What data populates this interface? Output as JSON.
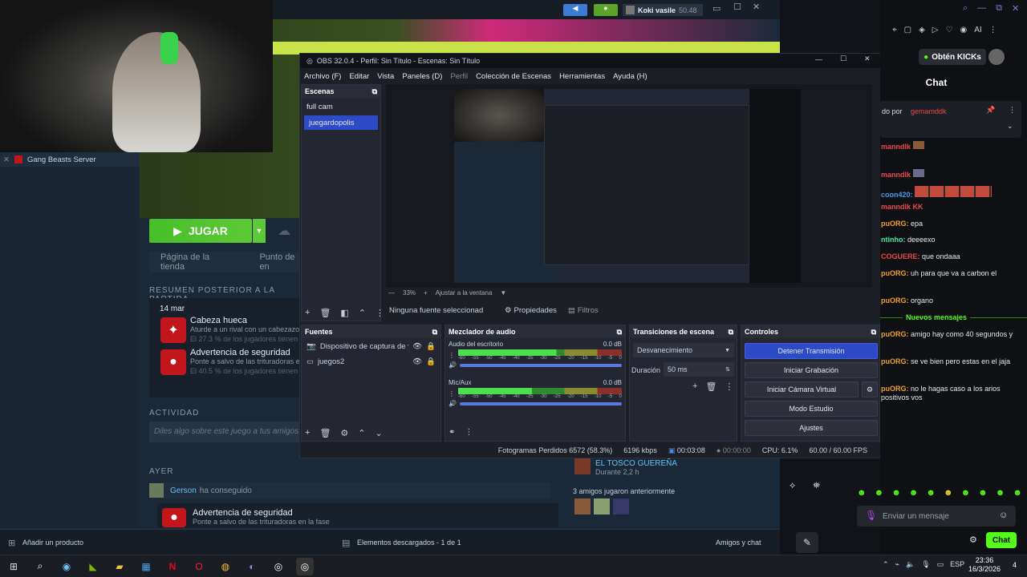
{
  "steam": {
    "game_title": "Gang Beasts Server",
    "user_name": "Koki vasile",
    "user_balance": "50.48",
    "play_label": "JUGAR",
    "tab_store": "Página de la tienda",
    "tab_point": "Punto de en",
    "summary_title": "RESUMEN POSTERIOR A LA PARTIDA",
    "summary_date": "14 mar",
    "achievements": [
      {
        "title": "Cabeza hueca",
        "desc": "Aturde a un rival con un cabezazo",
        "pct": "El 27.3 % de los jugadores tienen"
      },
      {
        "title": "Advertencia de seguridad",
        "desc": "Ponte a salvo de las trituradoras e",
        "pct": "El 40.5 % de los jugadores tienen"
      }
    ],
    "activity_title": "ACTIVIDAD",
    "comment_placeholder": "Diles algo sobre este juego a tus amigos...",
    "yesterday": "AYER",
    "friend_name": "Gerson",
    "friend_action": "ha conseguido",
    "friend_ach_title": "Advertencia de seguridad",
    "friend_ach_desc": "Ponte a salvo de las trituradoras en la fase",
    "side_friend": "EL TOSCO GUEREÑA",
    "side_friend_time": "Durante 2,2 h",
    "friends_played": "3 amigos jugaron anteriormente",
    "add_product": "Añadir un producto",
    "downloads": "Elementos descargados - 1 de 1",
    "friends_chat": "Amigos y chat"
  },
  "obs": {
    "title": "OBS 32.0.4 - Perfil: Sin Título - Escenas: Sin Título",
    "menu": [
      "Archivo (F)",
      "Editar",
      "Vista",
      "Paneles (D)",
      "Perfil",
      "Colección de Escenas",
      "Herramientas",
      "Ayuda (H)"
    ],
    "scenes_title": "Escenas",
    "scenes": [
      "full cam",
      "juegardopolis"
    ],
    "zoom": "33%",
    "fit_label": "Ajustar a la ventana",
    "no_source": "Ninguna fuente seleccionad",
    "properties": "Propiedades",
    "filters": "Filtros",
    "sources_title": "Fuentes",
    "sources": [
      "Dispositivo de captura de vid",
      "juegos2"
    ],
    "mixer_title": "Mezclador de audio",
    "mixer_channels": [
      {
        "name": "Audio del escritorio",
        "db": "0.0 dB"
      },
      {
        "name": "Mic/Aux",
        "db": "0.0 dB"
      }
    ],
    "mixer_ticks": [
      "-60",
      "-55",
      "-50",
      "-45",
      "-40",
      "-35",
      "-30",
      "-25",
      "-20",
      "-15",
      "-10",
      "-5",
      "0"
    ],
    "transitions_title": "Transiciones de escena",
    "transition_value": "Desvanecimiento",
    "duration_label": "Duración",
    "duration_value": "50 ms",
    "controls_title": "Controles",
    "controls": [
      "Detener Transmisión",
      "Iniciar Grabación",
      "Iniciar Cámara Virtual",
      "Modo Estudio",
      "Ajustes"
    ],
    "status": {
      "dropped": "Fotogramas Perdidos 6572 (58.3%)",
      "kbps": "6196 kbps",
      "stream_time": "00:03:08",
      "rec_time": "00:00:00",
      "cpu": "CPU: 6.1%",
      "fps": "60.00 / 60.00 FPS"
    }
  },
  "kick": {
    "get_kicks": "Obtén KICKs",
    "chat_title": "Chat",
    "pinned_by": "do por",
    "pinned_user": "gemamddk",
    "messages": [
      {
        "user": "manndlk",
        "text": ""
      },
      {
        "user": "manndlk",
        "text": ""
      },
      {
        "user": "coon420:",
        "text": ""
      },
      {
        "user": "manndlk",
        "text": ""
      },
      {
        "user": "puORG:",
        "text": "epa"
      },
      {
        "user": "ntinho:",
        "text": "deeeexo"
      },
      {
        "user": "COGUERE:",
        "text": "que ondaaa"
      },
      {
        "user": "puORG:",
        "text": "uh para que va a carbon el"
      },
      {
        "user": "puORG:",
        "text": "organo"
      }
    ],
    "new_messages": "Nuevos mensajes",
    "messages_after": [
      {
        "user": "puORG:",
        "text": "amigo hay como 40 segundos y"
      },
      {
        "user": "puORG:",
        "text": "se ve bien pero estas en el jaja"
      },
      {
        "user": "puORG:",
        "text": "no le hagas caso a los arios positivos vos"
      }
    ],
    "input_placeholder": "Enviar un mensaje",
    "send_label": "Chat"
  },
  "taskbar": {
    "lang": "ESP",
    "time": "23:36",
    "date": "16/3/2026",
    "notif_count": "4"
  }
}
